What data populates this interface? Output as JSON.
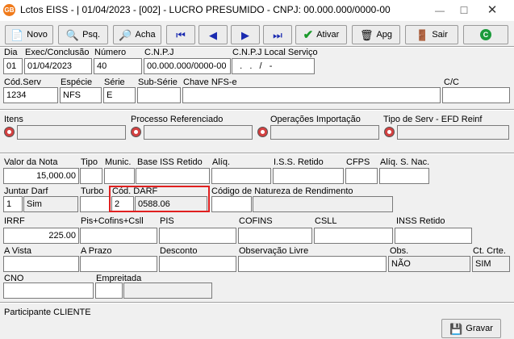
{
  "window": {
    "title": "Lctos EISS - | 01/04/2023 - [002] - LUCRO PRESUMIDO - CNPJ: 00.000.000/0000-00",
    "app_icon": "GB"
  },
  "toolbar": {
    "novo": "Novo",
    "psq": "Psq.",
    "acha": "Acha",
    "ativar": "Ativar",
    "apg": "Apg",
    "sair": "Sair"
  },
  "header": {
    "dia_label": "Dia",
    "dia": "01",
    "exec_label": "Exec/Conclusão",
    "exec": "01/04/2023",
    "numero_label": "Número",
    "numero": "40",
    "cnpj_label": "C.N.P.J",
    "cnpj": "00.000.000/0000-00",
    "cnpj_local_label": "C.N.P.J Local Serviço",
    "cnpj_local": "  .   .   /   -"
  },
  "servico": {
    "cod_label": "Cód.Serv",
    "cod": "1234",
    "especie_label": "Espécie",
    "especie": "NFS",
    "serie_label": "Série",
    "serie": "E",
    "subserie_label": "Sub-Série",
    "subserie": "",
    "chave_label": "Chave NFS-e",
    "chave": "",
    "cc_label": "C/C",
    "cc": ""
  },
  "links": {
    "itens": "Itens",
    "processo": "Processo Referenciado",
    "operacoes": "Operações Importação",
    "tipo_serv": "Tipo de Serv - EFD Reinf"
  },
  "valores": {
    "valor_nota_label": "Valor da Nota",
    "valor_nota": "15,000.00",
    "tipo_label": "Tipo",
    "munic_label": "Munic.",
    "base_iss_label": "Base ISS Retido",
    "aliq_label": "Alíq.",
    "iss_retido_label": "I.S.S. Retido",
    "cfps_label": "CFPS",
    "aliq_snac_label": "Alíq. S. Nac."
  },
  "darf": {
    "juntar_label": "Juntar Darf",
    "juntar_code": "1",
    "juntar_value": "Sim",
    "turbo_label": "Turbo",
    "cod_darf_label": "Cód. DARF",
    "cod_darf_code": "2",
    "cod_darf_value": "0588.06",
    "natureza_label": "Código de Natureza de Rendimento"
  },
  "impostos": {
    "irrf_label": "IRRF",
    "irrf": "225.00",
    "pis_cofins_label": "Pis+Cofins+Csll",
    "pis_label": "PIS",
    "cofins_label": "COFINS",
    "csll_label": "CSLL",
    "inss_label": "INSS Retido"
  },
  "pagamento": {
    "avista_label": "A Vista",
    "aprazo_label": "A Prazo",
    "desconto_label": "Desconto",
    "obs_livre_label": "Observação Livre",
    "obs_label": "Obs.",
    "obs": "NÃO",
    "ct_crte_label": "Ct. Crte.",
    "ct_crte": "SIM"
  },
  "extra": {
    "cno_label": "CNO",
    "empreitada_label": "Empreitada"
  },
  "footer": {
    "participante": "Participante CLIENTE",
    "gravar": "Gravar"
  }
}
